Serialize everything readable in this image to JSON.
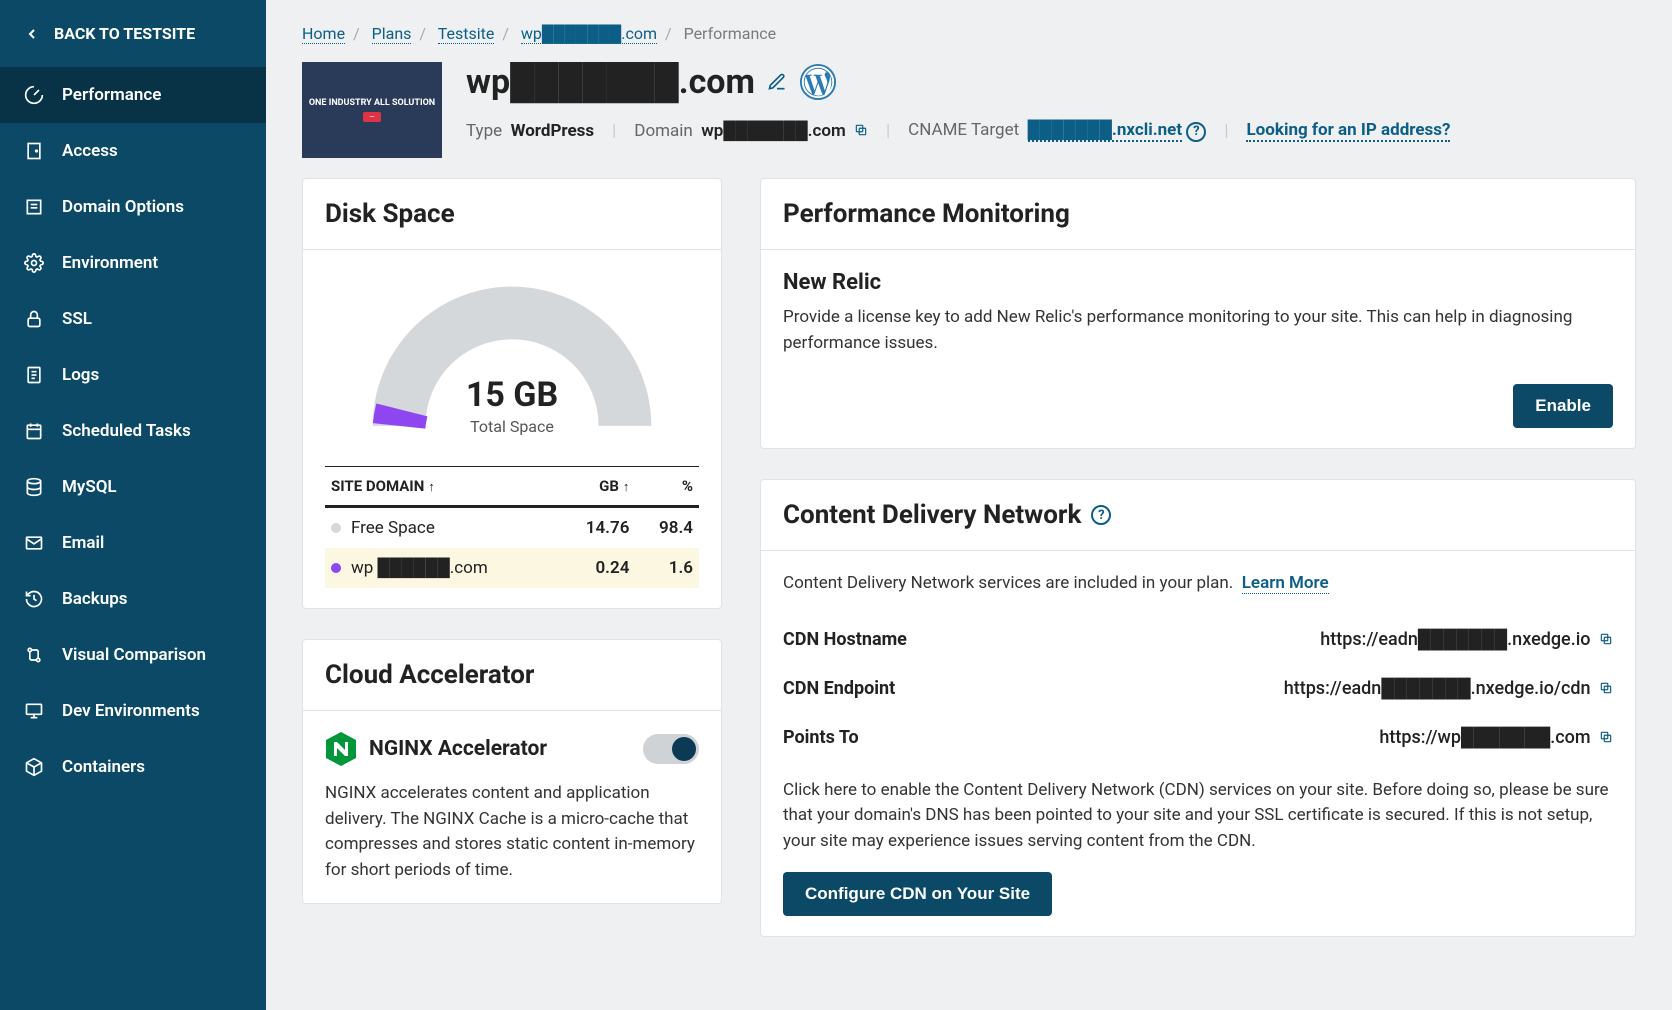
{
  "sidebar": {
    "back_label": "BACK TO TESTSITE",
    "items": [
      {
        "label": "Performance",
        "icon": "gauge-icon",
        "active": true
      },
      {
        "label": "Access",
        "icon": "door-icon"
      },
      {
        "label": "Domain Options",
        "icon": "list-icon"
      },
      {
        "label": "Environment",
        "icon": "gear-icon"
      },
      {
        "label": "SSL",
        "icon": "lock-icon"
      },
      {
        "label": "Logs",
        "icon": "file-icon"
      },
      {
        "label": "Scheduled Tasks",
        "icon": "calendar-icon"
      },
      {
        "label": "MySQL",
        "icon": "database-icon"
      },
      {
        "label": "Email",
        "icon": "mail-icon"
      },
      {
        "label": "Backups",
        "icon": "history-icon"
      },
      {
        "label": "Visual Comparison",
        "icon": "compare-icon"
      },
      {
        "label": "Dev Environments",
        "icon": "monitor-icon"
      },
      {
        "label": "Containers",
        "icon": "package-icon"
      }
    ]
  },
  "breadcrumb": {
    "items": [
      "Home",
      "Plans",
      "Testsite",
      "wp███████.com"
    ],
    "current": "Performance"
  },
  "header": {
    "thumb_promo": "ONE INDUSTRY ALL SOLUTION",
    "site_title": "wp███████.com",
    "type_label": "Type",
    "type_value": "WordPress",
    "domain_label": "Domain",
    "domain_value": "wp███████.com",
    "cname_label": "CNAME Target",
    "cname_value": "███████.nxcli.net",
    "ip_link": "Looking for an IP address?"
  },
  "disk": {
    "title": "Disk Space",
    "gauge_heading": "15 GB",
    "gauge_sub": "Total Space",
    "col1": "SITE DOMAIN",
    "col2": "GB",
    "col3": "%",
    "rows": [
      {
        "name": "Free Space",
        "gb": "14.76",
        "pct": "98.4",
        "color": "gray"
      },
      {
        "name": "wp ██████.com",
        "gb": "0.24",
        "pct": "1.6",
        "color": "purple",
        "hl": true
      }
    ]
  },
  "accel": {
    "title": "Cloud Accelerator",
    "nginx_title": "NGINX Accelerator",
    "desc": "NGINX accelerates content and application delivery. The NGINX Cache is a micro-cache that compresses and stores static content in-memory for short periods of time.",
    "toggle_on": true
  },
  "perfmon": {
    "title": "Performance Monitoring",
    "sub": "New Relic",
    "desc": "Provide a license key to add New Relic's performance monitoring to your site. This can help in diagnosing performance issues.",
    "enable_label": "Enable"
  },
  "cdn": {
    "title": "Content Delivery Network",
    "intro": "Content Delivery Network services are included in your plan.",
    "learn_more": "Learn More",
    "rows": [
      {
        "k": "CDN Hostname",
        "v": "https://eadn███████.nxedge.io"
      },
      {
        "k": "CDN Endpoint",
        "v": "https://eadn███████.nxedge.io/cdn"
      },
      {
        "k": "Points To",
        "v": "https://wp███████.com"
      }
    ],
    "desc": "Click here to enable the Content Delivery Network (CDN) services on your site. Before doing so, please be sure that your domain's DNS has been pointed to your site and your SSL certificate is secured. If this is not setup, your site may experience issues serving content from the CDN.",
    "configure_label": "Configure CDN on Your Site"
  },
  "chart_data": {
    "type": "pie",
    "title": "Disk Space",
    "categories": [
      "Free Space",
      "wp ██████.com"
    ],
    "values": [
      14.76,
      0.24
    ],
    "percentages": [
      98.4,
      1.6
    ],
    "total_label": "15 GB",
    "total_sub": "Total Space",
    "colors": [
      "#d5d8db",
      "#8d46f0"
    ]
  }
}
